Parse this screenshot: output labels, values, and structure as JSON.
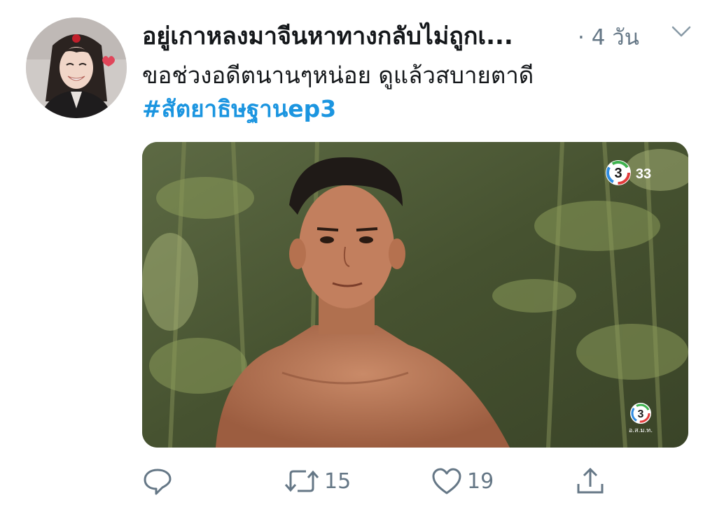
{
  "tweet": {
    "display_name": "อยู่เกาหลงมาจีนหาทางกลับไม่ถูกเ...",
    "time": "· 4 วัน",
    "text_line": "ขอช่วงอดีตนานๆหน่อย ดูแล้วสบายตาดี",
    "hashtag": "#สัตยาธิษฐานep3"
  },
  "media": {
    "channel_logo_number": "3",
    "channel_badge_text": "33",
    "small_logo_caption": "อ.ส.ม.ท."
  },
  "actions": {
    "retweet_count": "15",
    "like_count": "19"
  },
  "colors": {
    "hashtag": "#1b95e0",
    "secondary_text": "#657786",
    "primary_text": "#14171a"
  }
}
